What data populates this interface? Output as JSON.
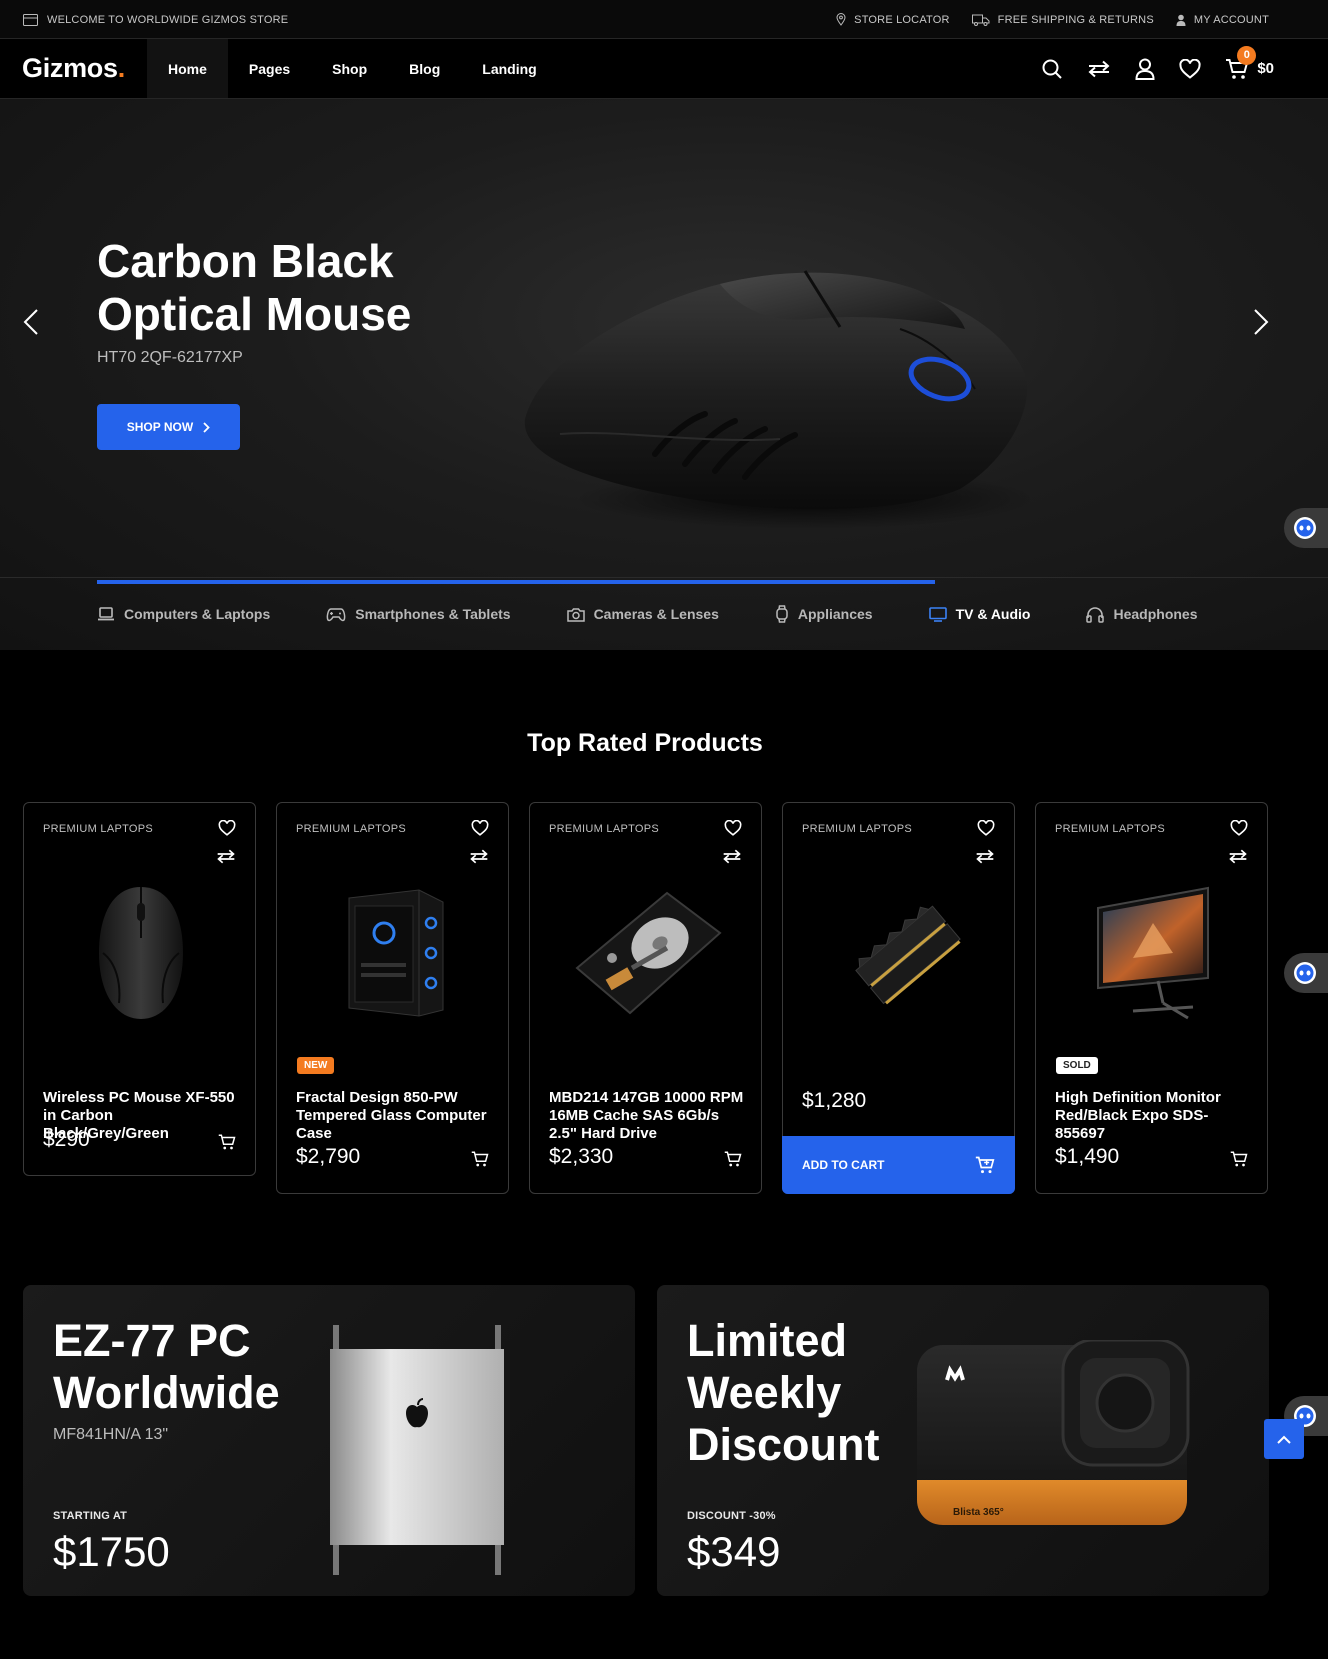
{
  "topbar": {
    "welcome": "WELCOME TO WORLDWIDE GIZMOS STORE",
    "store_locator": "STORE LOCATOR",
    "shipping": "FREE SHIPPING & RETURNS",
    "account": "MY ACCOUNT"
  },
  "header": {
    "logo": "Gizmos",
    "logo_dot": ".",
    "nav": [
      {
        "label": "Home",
        "active": true
      },
      {
        "label": "Pages"
      },
      {
        "label": "Shop"
      },
      {
        "label": "Blog"
      },
      {
        "label": "Landing"
      }
    ],
    "icons": [
      "search-icon",
      "compare-icon",
      "user-icon",
      "heart-icon",
      "cart-icon"
    ],
    "cart_count": "0",
    "cart_total": "$0"
  },
  "hero": {
    "title": "Carbon Black Optical Mouse",
    "subtitle": "HT70 2QF-62177XP",
    "button": "SHOP NOW",
    "slide_progress": 0.838,
    "categories": [
      {
        "label": "Computers & Laptops",
        "icon": "laptop-icon"
      },
      {
        "label": "Smartphones & Tablets",
        "icon": "gamepad-icon"
      },
      {
        "label": "Cameras & Lenses",
        "icon": "camera-icon"
      },
      {
        "label": "Appliances",
        "icon": "watch-icon"
      },
      {
        "label": "TV & Audio",
        "icon": "tv-icon",
        "active": true
      },
      {
        "label": "Headphones",
        "icon": "headphones-icon"
      }
    ]
  },
  "top_rated": {
    "title": "Top Rated Products",
    "products": [
      {
        "tag": "PREMIUM LAPTOPS",
        "name": "Wireless PC Mouse XF-550 in Carbon Black/Grey/Green",
        "price": "$290",
        "badge": ""
      },
      {
        "tag": "PREMIUM LAPTOPS",
        "name": "Fractal Design 850-PW Tempered Glass Computer Case",
        "price": "$2,790",
        "badge": "NEW"
      },
      {
        "tag": "PREMIUM LAPTOPS",
        "name": "MBD214 147GB 10000 RPM 16MB Cache SAS 6Gb/s 2.5\" Hard Drive",
        "price": "$2,330",
        "badge": ""
      },
      {
        "tag": "PREMIUM LAPTOPS",
        "name": "",
        "price": "$1,280",
        "badge": "",
        "add_to_cart": "ADD TO CART"
      },
      {
        "tag": "PREMIUM LAPTOPS",
        "name": "High Definition Monitor Red/Black Expo SDS-855697",
        "price": "$1,490",
        "badge": "SOLD"
      }
    ]
  },
  "banners": [
    {
      "title": "EZ-77 PC Worldwide",
      "subtitle": "MF841HN/A 13\"",
      "label": "STARTING AT",
      "price": "$1750"
    },
    {
      "title": "Limited Weekly Discount",
      "subtitle": "",
      "label": "DISCOUNT -30%",
      "price": "$349",
      "product_text": "Blista 365°"
    }
  ],
  "colors": {
    "accent": "#2563eb",
    "brand_orange": "#f47b20",
    "background": "#000000"
  }
}
